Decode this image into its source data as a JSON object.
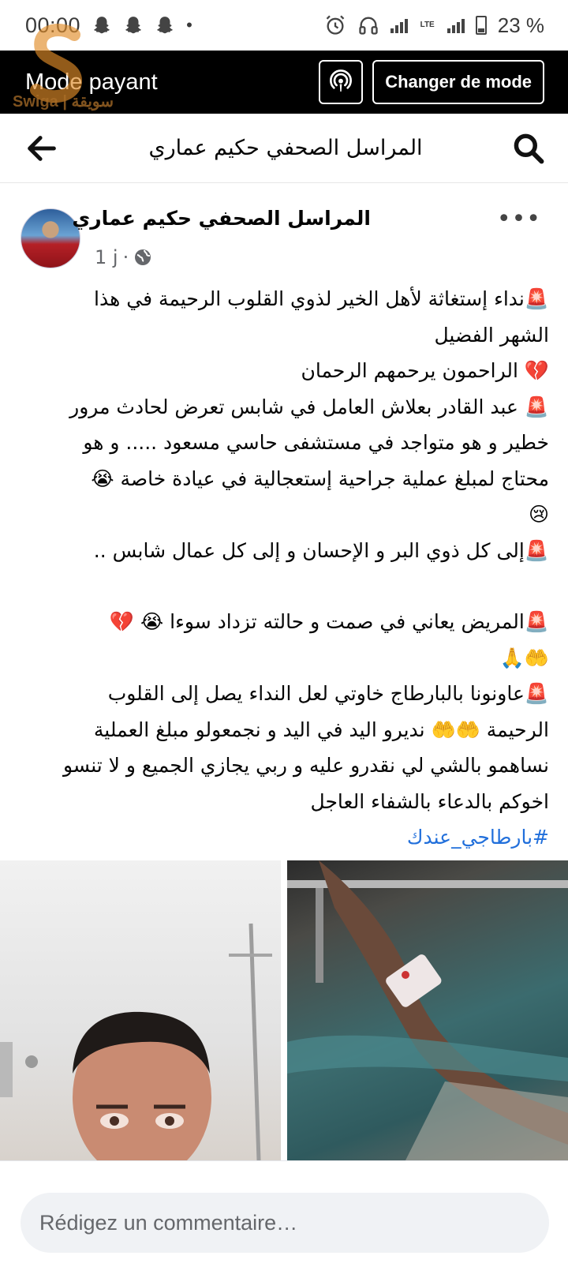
{
  "status_bar": {
    "time": "00:00",
    "battery": "23 %",
    "network": "LTE"
  },
  "mode_bar": {
    "title": "Mode payant",
    "change_mode_label": "Changer de mode",
    "podcast_icon": "podcast-icon"
  },
  "watermark": {
    "text": "Swiga | سويقة"
  },
  "header": {
    "title": "المراسل الصحفي حكيم عماري",
    "back_icon": "arrow-left-icon",
    "search_icon": "search-icon"
  },
  "post": {
    "author": "المراسل الصحفي حكيم عماري",
    "time": "1 j",
    "separator": "·",
    "audience_icon": "globe-icon",
    "more_icon": "more-horizontal-icon",
    "lines": [
      "🚨نداء إستغاثة لأهل الخير لذوي القلوب الرحيمة في هذا",
      "الشهر الفضيل",
      "💔 الراحمون يرحمهم الرحمان",
      "🚨 عبد القادر بعلاش العامل في شابس تعرض لحادث مرور",
      "خطير و هو متواجد في مستشفى حاسي مسعود ..... و هو",
      "محتاج لمبلغ عملية جراحية إستعجالية في عيادة خاصة 😭",
      "😢",
      "🚨إلى كل ذوي البر و الإحسان و إلى كل عمال شابس ..",
      "",
      "🚨المريض يعاني في صمت و حالته تزداد سوءا  😭 💔",
      "🤲🙏",
      "🚨عاونونا بالبارطاج خاوتي لعل النداء يصل إلى القلوب",
      "الرحيمة 🤲🤲 نديرو اليد في اليد و نجمعولو مبلغ العملية",
      "نساهمو بالشي لي نقدرو عليه و ربي يجازي الجميع و لا تنسو",
      "اخوكم بالدعاء بالشفاء العاجل"
    ],
    "hashtag": "#بارطاجي_عندك"
  },
  "comment": {
    "placeholder": "Rédigez un commentaire…"
  }
}
